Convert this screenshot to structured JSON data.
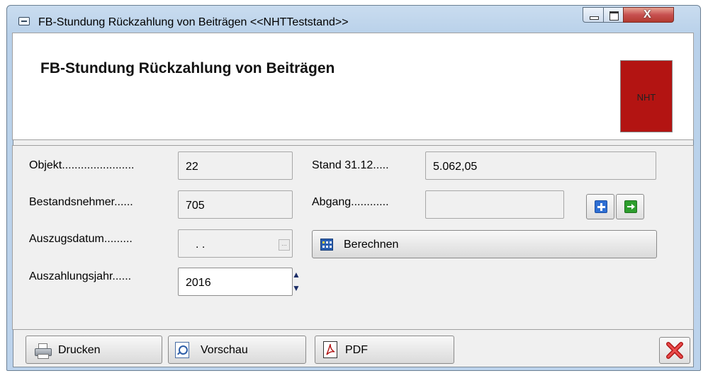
{
  "window": {
    "title": "FB-Stundung Rückzahlung von Beiträgen  <<NHTTeststand>>",
    "buttons": [
      "minimize",
      "maximize",
      "close"
    ],
    "close_glyph": "X"
  },
  "header": {
    "title": "FB-Stundung Rückzahlung von Beiträgen",
    "logo_text": "NHT",
    "logo_color": "#b31412"
  },
  "form": {
    "objekt_label": "Objekt.......................",
    "objekt_value": "22",
    "bestandsnehmer_label": "Bestandsnehmer......",
    "bestandsnehmer_value": "705",
    "auszugsdatum_label": "Auszugsdatum.........",
    "auszugsdatum_value": ". .",
    "auszahlungsjahr_label": "Auszahlungsjahr......",
    "auszahlungsjahr_value": "2016",
    "stand_label": "Stand 31.12.....",
    "stand_value": "5.062,05",
    "abgang_label": "Abgang............",
    "abgang_value": "",
    "berechnen_label": "Berechnen"
  },
  "footer": {
    "drucken_label": "Drucken",
    "vorschau_label": "Vorschau",
    "pdf_label": "PDF"
  },
  "icons": {
    "add": "plus-icon",
    "apply": "arrow-right-icon",
    "calculate": "calculator-icon",
    "print": "printer-icon",
    "preview": "magnifier-page-icon",
    "pdf": "pdf-icon",
    "close": "red-x-icon"
  }
}
